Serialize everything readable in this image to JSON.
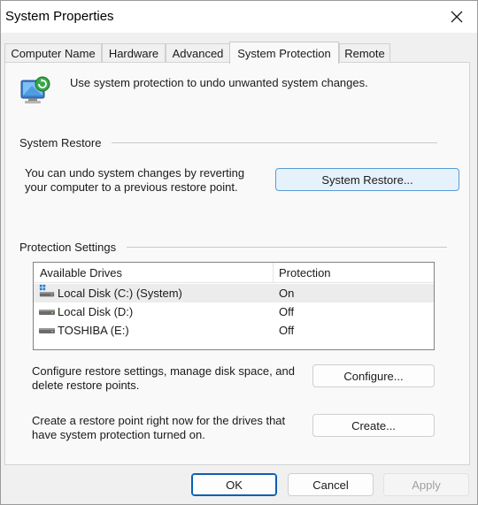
{
  "window": {
    "title": "System Properties"
  },
  "tabs": [
    {
      "label": "Computer Name",
      "active": false
    },
    {
      "label": "Hardware",
      "active": false
    },
    {
      "label": "Advanced",
      "active": false
    },
    {
      "label": "System Protection",
      "active": true
    },
    {
      "label": "Remote",
      "active": false
    }
  ],
  "intro": {
    "icon": "system-protection-icon",
    "text": "Use system protection to undo unwanted system changes."
  },
  "system_restore": {
    "heading": "System Restore",
    "description_line1": "You can undo system changes by reverting",
    "description_line2": "your computer to a previous restore point.",
    "button_label": "System Restore..."
  },
  "protection_settings": {
    "heading": "Protection Settings",
    "columns": [
      "Available Drives",
      "Protection"
    ],
    "drives": [
      {
        "name": "Local Disk (C:) (System)",
        "protection": "On",
        "icon": "system-drive-icon",
        "selected": true
      },
      {
        "name": "Local Disk (D:)",
        "protection": "Off",
        "icon": "drive-icon",
        "selected": false
      },
      {
        "name": "TOSHIBA (E:)",
        "protection": "Off",
        "icon": "drive-icon",
        "selected": false
      }
    ],
    "configure_text_line1": "Configure restore settings, manage disk space, and",
    "configure_text_line2": "delete restore points.",
    "configure_button": "Configure...",
    "create_text_line1": "Create a restore point right now for the drives that",
    "create_text_line2": "have system protection turned on.",
    "create_button": "Create..."
  },
  "footer": {
    "ok": "OK",
    "cancel": "Cancel",
    "apply": "Apply"
  },
  "colors": {
    "accent_border": "#0a5fb4",
    "restore_button_bg": "#e5f1fb"
  }
}
